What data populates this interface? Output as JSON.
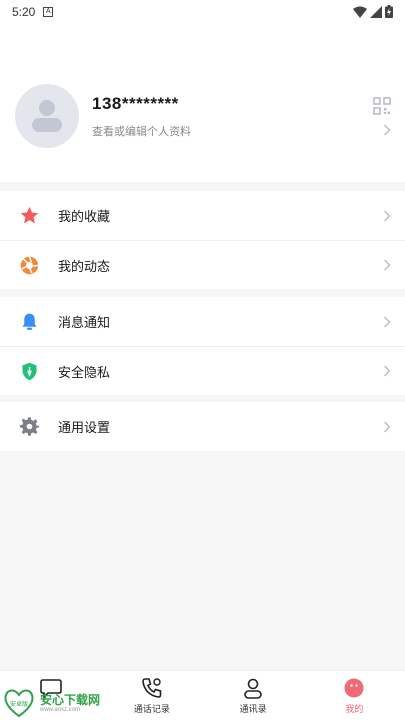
{
  "status_bar": {
    "time": "5:20",
    "notification_glyph": "A"
  },
  "profile": {
    "name": "138********",
    "subtitle": "查看或编辑个人资料"
  },
  "menu": {
    "group1": [
      {
        "label": "我的收藏",
        "icon": "star-icon",
        "color": "#f15b5b"
      },
      {
        "label": "我的动态",
        "icon": "aperture-icon",
        "color": "#f08a3a"
      }
    ],
    "group2": [
      {
        "label": "消息通知",
        "icon": "bell-icon",
        "color": "#3a8ef6"
      },
      {
        "label": "安全隐私",
        "icon": "shield-icon",
        "color": "#22c07a"
      }
    ],
    "group3": [
      {
        "label": "通用设置",
        "icon": "gear-icon",
        "color": "#7a7f8a"
      }
    ]
  },
  "tabbar": {
    "tabs": [
      {
        "label": "",
        "icon": "chat-icon"
      },
      {
        "label": "通话记录",
        "icon": "call-log-icon"
      },
      {
        "label": "通讯录",
        "icon": "contacts-icon"
      },
      {
        "label": "我的",
        "icon": "me-icon",
        "active": true
      }
    ],
    "active_color": "#f06a75"
  },
  "watermark": {
    "logo_text": "安心下载网",
    "url": "www.anxz.com",
    "badge": "安卓版"
  }
}
